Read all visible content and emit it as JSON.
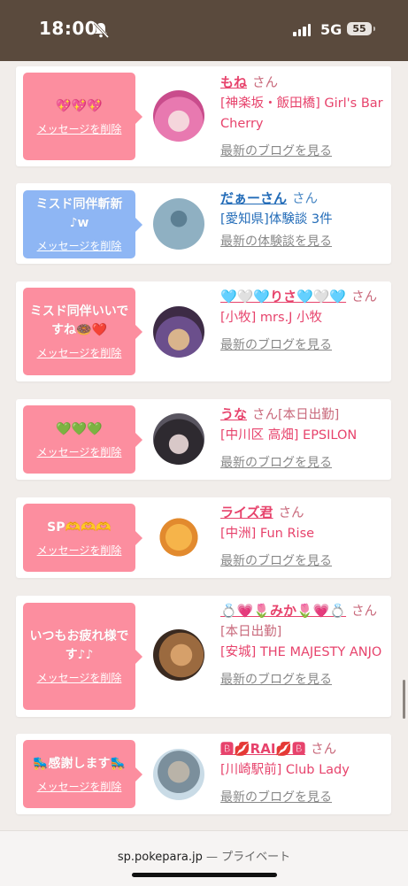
{
  "status": {
    "time": "18:00",
    "network": "5G",
    "battery": "55"
  },
  "cards": [
    {
      "message": "💖💖💖",
      "delete": "メッセージを削除",
      "name": "もね",
      "suffix": "さん",
      "extra": "",
      "shop": "[神楽坂・飯田橋] Girl's Bar Cherry",
      "link": "最新のブログを見る",
      "bubble": "pink",
      "avatar": "pink-hair"
    },
    {
      "message": "ミスド同伴斬新♪w",
      "delete": "メッセージを削除",
      "name": "だぁーさん",
      "suffix": "さん",
      "extra": "",
      "shop": "[愛知県]体験談 3件",
      "link": "最新の体験談を見る",
      "bubble": "blue",
      "avatar": "no-photo"
    },
    {
      "message": "ミスド同伴いいですね🍩❤️",
      "delete": "メッセージを削除",
      "name": "🩵🤍🩵りさ🩵🤍🩵",
      "suffix": "さん",
      "extra": "",
      "shop": "[小牧] mrs.J 小牧",
      "link": "最新のブログを見る",
      "bubble": "pink",
      "avatar": "purple-hair"
    },
    {
      "message": "💚💚💚",
      "delete": "メッセージを削除",
      "name": "うな",
      "suffix": "さん",
      "extra": "[本日出勤]",
      "shop": "[中川区 高畑] EPSILON",
      "link": "最新のブログを見る",
      "bubble": "pink",
      "avatar": "dark-hair"
    },
    {
      "message": "SP🫶🫶🫶",
      "delete": "メッセージを削除",
      "name": "ライズ君",
      "suffix": "さん",
      "extra": "",
      "shop": "[中洲] Fun Rise",
      "link": "最新のブログを見る",
      "bubble": "pink",
      "avatar": "mascot"
    },
    {
      "message": "いつもお疲れ様です♪♪",
      "delete": "メッセージを削除",
      "name": "💍💗🌷みか🌷💗💍",
      "suffix": "さん",
      "extra": "[本日出勤]",
      "shop": "[安城] THE MAJESTY ANJO",
      "link": "最新のブログを見る",
      "bubble": "pink",
      "avatar": "blonde"
    },
    {
      "message": "🛼感謝します🛼",
      "delete": "メッセージを削除",
      "name": "🅱💋RAI💋🅱",
      "suffix": "さん",
      "extra": "",
      "shop": "[川崎駅前] Club Lady",
      "link": "最新のブログを見る",
      "bubble": "pink",
      "avatar": "statue"
    }
  ],
  "browser": {
    "url": "sp.pokepara.jp",
    "separator": "—",
    "mode": "プライベート"
  }
}
